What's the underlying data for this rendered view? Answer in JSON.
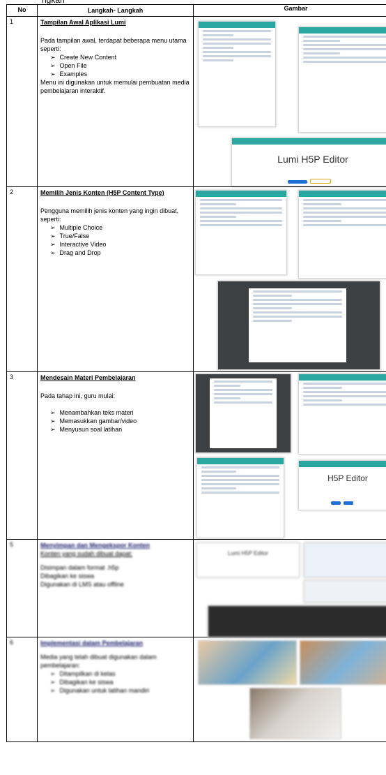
{
  "top_fragment": "ngkah",
  "table": {
    "headers": {
      "no": "No",
      "steps": "Langkah- Langkah",
      "image": "Gambar"
    },
    "rows": [
      {
        "no": "1",
        "title": "Tampilan Awal Aplikasi Lumi",
        "intro": "Pada tampilan awal, terdapat beberapa menu utama seperti:",
        "bullets": [
          "Create New Content",
          "Open File",
          "Examples"
        ],
        "outro": "Menu ini digunakan untuk memulai pembuatan media pembelajaran interaktif."
      },
      {
        "no": "2",
        "title": "Memilih Jenis Konten (H5P Content Type)",
        "intro": "Pengguna memilih jenis konten yang ingin dibuat, seperti:",
        "bullets": [
          "Multiple Choice",
          "True/False",
          "Interactive Video",
          "Drag and Drop"
        ]
      },
      {
        "no": "3",
        "title": "Mendesain Materi Pembelajaran",
        "intro": "Pada tahap ini, guru mulai:",
        "bullets": [
          "Menambahkan teks materi",
          "Memasukkan gambar/video",
          "Menyusun soal latihan"
        ]
      },
      {
        "no": "5",
        "title": "Menyimpan dan Mengekspor Konten",
        "intro": "Konten yang sudah dibuat dapat:",
        "lines": [
          "Disimpan dalam format .h5p",
          "Dibagikan ke siswa",
          "Digunakan di LMS atau offline"
        ]
      },
      {
        "no": "6",
        "title": "Implementasi dalam Pembelajaran",
        "intro": "Media yang telah dibuat digunakan dalam pembelajaran:",
        "bullets": [
          "Ditampilkan di kelas",
          "Dibagikan ke siswa",
          "Digunakan untuk latihan mandiri"
        ]
      }
    ]
  },
  "thumbnails": {
    "editor_title": "Lumi H5P Editor",
    "editor_title_2": "H5P Editor",
    "export_title": "Lumi H5P Editor"
  },
  "colors": {
    "lumi_teal": "#2aa7a0",
    "accent_blue": "#1e6fd6"
  }
}
